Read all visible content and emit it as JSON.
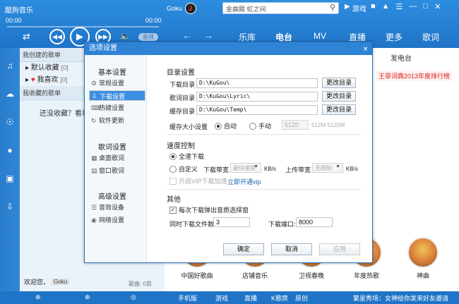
{
  "app": {
    "brand": "酷狗音乐",
    "user_name": "Goku",
    "search_text": "金曲踢  虹之间",
    "game_label": "游戏",
    "time_start": "00:00",
    "time_end": "00:00",
    "sound_badge": "音效",
    "nav": [
      "乐库",
      "电台",
      "MV",
      "直播",
      "更多",
      "歌词"
    ],
    "nav_active": "电台"
  },
  "left_panel": {
    "created_header": "我创建的歌单",
    "playlists": [
      {
        "label": "默认收藏",
        "count": "[0]"
      },
      {
        "label": "我喜欢",
        "count": "[0]"
      }
    ],
    "collected_header": "我收藏的歌单",
    "collect_note_prefix": "还没收藏？看看",
    "collect_note_link": "",
    "logged_in_label": "欢迎您，",
    "logged_in_user": "Goku",
    "song_count": "歌曲: 0首"
  },
  "content": {
    "ad_text": "发电台",
    "promo": "王菲词典2013年度排行榜",
    "tiles": [
      "中国好歌曲",
      "店铺音乐",
      "卫视春晚",
      "年度热歌",
      "神曲"
    ]
  },
  "bottombar": {
    "items": [
      "手机版",
      "游戏",
      "直播",
      "K歌房",
      "原创"
    ],
    "ticker": "繁星秀场：女神给你发来好友邀请"
  },
  "dialog": {
    "title": "选项设置",
    "close_icon": "close-icon",
    "sidebar": {
      "group_basic": "基本设置",
      "items_basic": [
        "常规设置",
        "下载设置",
        "热键设置",
        "软件更新"
      ],
      "group_lyrics": "歌词设置",
      "items_lyrics": [
        "桌面歌词",
        "窗口歌词"
      ],
      "group_advanced": "高级设置",
      "items_advanced": [
        "音效设备",
        "网络设置"
      ],
      "selected": "下载设置"
    },
    "dir_section": "目录设置",
    "dirs": [
      {
        "label": "下载目录",
        "path": "D:\\KuGou\\",
        "button": "更改目录"
      },
      {
        "label": "歌词目录",
        "path": "D:\\KuGou\\Lyric\\",
        "button": "更改目录"
      },
      {
        "label": "缓存目录",
        "path": "D:\\KuGou\\Temp\\",
        "button": "更改目录"
      }
    ],
    "cache_size_label": "缓存大小设置",
    "cache_auto": "自动",
    "cache_manual": "手动",
    "cache_value": "5120",
    "cache_range": "512M-5120M",
    "speed_section": "速度控制",
    "speed_full": "全速下载",
    "speed_custom": "自定义",
    "download_bw_label": "下载带宽",
    "download_bw_value": "最快速度",
    "unit_kbs_1": "KB/s",
    "upload_bw_label": "上传带宽",
    "upload_bw_value": "无限制",
    "unit_kbs_2": "KB/s",
    "vip_checkbox": "开启VIP下载加速",
    "vip_link": "立即开通vip",
    "other_section": "其他",
    "quality_checkbox": "每次下载弹出音质选择窗",
    "concurrent_label": "同时下载文件数:",
    "concurrent_value": "3",
    "port_label": "下载端口:",
    "port_value": "8000",
    "ok_button": "确定",
    "cancel_button": "取消",
    "apply_button": "应用"
  }
}
